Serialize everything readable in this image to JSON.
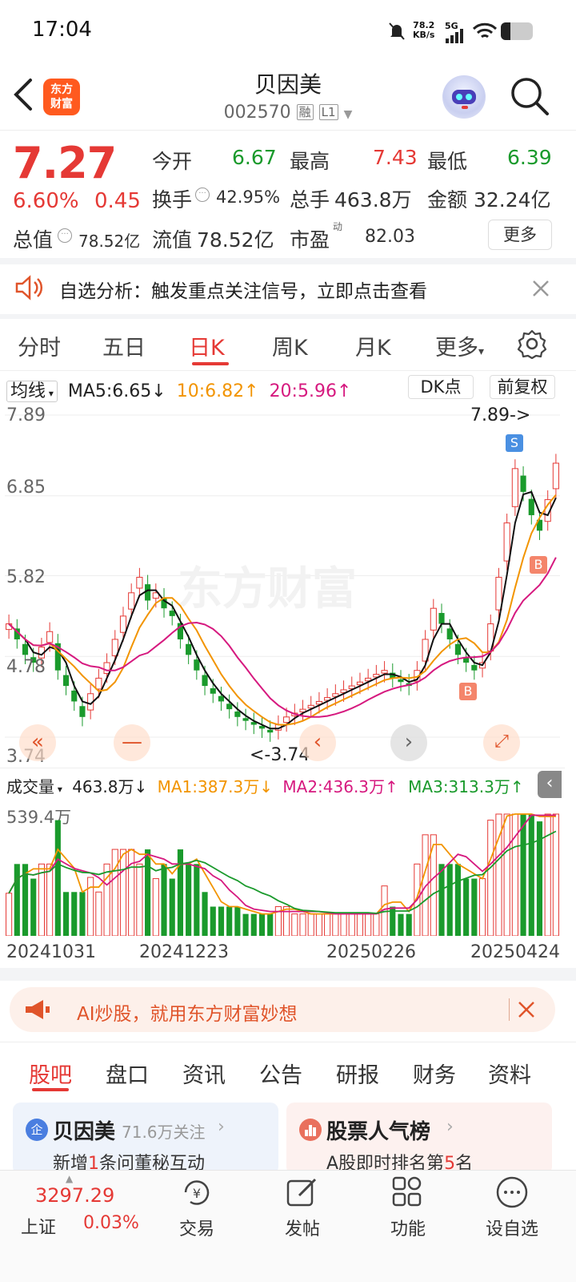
{
  "status_bar": {
    "time": "17:04",
    "net_speed": "78.2",
    "net_unit": "KB/s",
    "network": "5G"
  },
  "header": {
    "logo_text_line1": "东方",
    "logo_text_line2": "财富",
    "stock_name": "贝因美",
    "stock_code": "002570",
    "tag_margin": "融",
    "tag_level": "L1"
  },
  "quote": {
    "price": "7.27",
    "change_pct": "6.60%",
    "change_amt": "0.45",
    "open_label": "今开",
    "open": "6.67",
    "high_label": "最高",
    "high": "7.43",
    "low_label": "最低",
    "low": "6.39",
    "turnover_label": "换手",
    "turnover": "42.95%",
    "volume_label": "总手",
    "volume": "463.8万",
    "amount_label": "金额",
    "amount": "32.24亿",
    "mktcap_label": "总值",
    "mktcap": "78.52亿",
    "float_label": "流值",
    "float_cap": "78.52亿",
    "pe_label": "市盈",
    "pe_sup": "动",
    "pe": "82.03",
    "more": "更多"
  },
  "alert": {
    "text": "自选分析：触发重点关注信号，立即点击查看"
  },
  "kline_tabs": [
    "分时",
    "五日",
    "日K",
    "周K",
    "月K",
    "更多"
  ],
  "chart_toolbar": {
    "ma_selector": "均线",
    "ma5": "MA5:6.65",
    "ma10": "10:6.82",
    "ma20": "20:5.96",
    "dk_button": "DK点",
    "adjust_button": "前复权"
  },
  "price_axis": [
    "7.89",
    "6.85",
    "5.82",
    "4.78",
    "3.74"
  ],
  "chart_annotations": {
    "high_mark": "7.89->",
    "low_mark": "<-3.74",
    "sell_badge": "S",
    "buy_badge": "B",
    "watermark": "东方财富"
  },
  "volume_toolbar": {
    "selector": "成交量",
    "volume": "463.8万",
    "ma1": "MA1:387.3万",
    "ma2": "MA2:436.3万",
    "ma3": "MA3:313.3万",
    "max_label": "539.4万"
  },
  "date_axis": [
    "20241031",
    "20241223",
    "20250226",
    "20250424"
  ],
  "ai_banner": {
    "text": "AI炒股，就用东方财富妙想"
  },
  "section_tabs": [
    "股吧",
    "盘口",
    "资讯",
    "公告",
    "研报",
    "财务",
    "资料"
  ],
  "cards": [
    {
      "icon": "企",
      "title": "贝因美",
      "sub_count": "71.6万关注",
      "line_prefix": "新增",
      "line_num": "1",
      "line_suffix": "条问董秘互动"
    },
    {
      "title": "股票人气榜",
      "line_prefix": "A股即时排名第",
      "line_num": "5",
      "line_suffix": "名"
    }
  ],
  "bottom_nav": {
    "index_value": "3297.29",
    "index_name": "上证",
    "index_change": "0.03%",
    "items": [
      "交易",
      "发帖",
      "功能",
      "设自选"
    ]
  },
  "colors": {
    "up": "#e53935",
    "down": "#1a9a2c",
    "accent": "#e53935",
    "ma10": "#f29400",
    "ma20": "#d6197f"
  },
  "chart_data": {
    "type": "candlestick",
    "x_labels": [
      "20241031",
      "20241223",
      "20250226",
      "20250424"
    ],
    "ylim": [
      3.74,
      7.89
    ],
    "y_ticks": [
      3.74,
      4.78,
      5.82,
      6.85,
      7.89
    ],
    "closes": [
      5.2,
      5.0,
      4.8,
      4.7,
      4.9,
      5.1,
      4.6,
      4.4,
      4.2,
      4.0,
      4.3,
      4.5,
      4.7,
      5.0,
      5.3,
      5.6,
      5.8,
      5.5,
      5.6,
      5.4,
      5.3,
      5.0,
      4.8,
      4.6,
      4.4,
      4.3,
      4.2,
      4.1,
      4.0,
      3.95,
      3.9,
      3.85,
      3.8,
      3.9,
      4.0,
      4.05,
      4.1,
      4.15,
      4.2,
      4.25,
      4.3,
      4.35,
      4.4,
      4.45,
      4.5,
      4.55,
      4.6,
      4.5,
      4.45,
      4.4,
      4.6,
      5.0,
      5.4,
      5.2,
      5.0,
      4.8,
      4.7,
      4.6,
      4.7,
      5.2,
      5.8,
      6.5,
      7.2,
      6.9,
      6.6,
      6.4,
      6.8,
      7.27
    ]
  }
}
